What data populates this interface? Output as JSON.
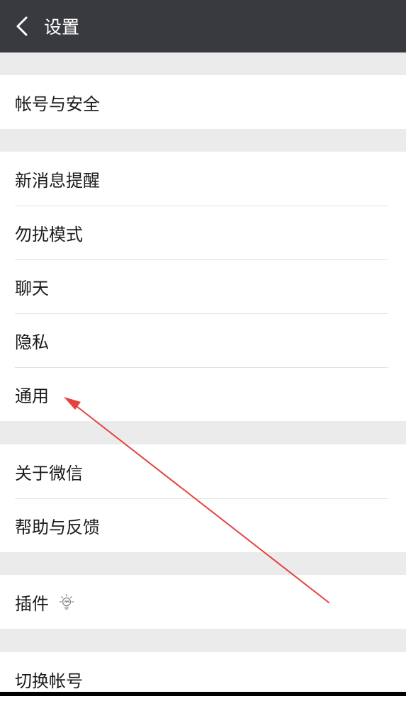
{
  "header": {
    "title": "设置",
    "back_icon": "chevron-left-icon",
    "background": "#393a3f"
  },
  "groups": [
    {
      "items": [
        {
          "label": "帐号与安全"
        }
      ]
    },
    {
      "items": [
        {
          "label": "新消息提醒"
        },
        {
          "label": "勿扰模式"
        },
        {
          "label": "聊天"
        },
        {
          "label": "隐私"
        },
        {
          "label": "通用"
        }
      ]
    },
    {
      "items": [
        {
          "label": "关于微信"
        },
        {
          "label": "帮助与反馈"
        }
      ]
    },
    {
      "items": [
        {
          "label": "插件",
          "icon": "lightbulb-icon"
        }
      ]
    },
    {
      "items": [
        {
          "label": "切换帐号"
        }
      ]
    }
  ],
  "annotation": {
    "type": "arrow",
    "color": "#e8423f",
    "points_to": "通用"
  }
}
